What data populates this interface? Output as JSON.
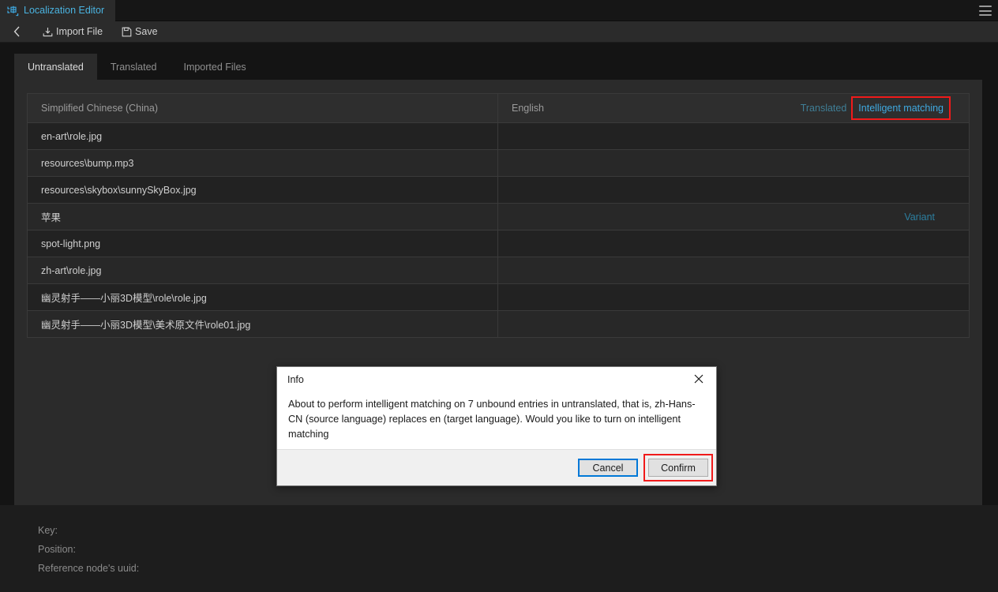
{
  "titlebar": {
    "editor_tab_label": "Localization Editor",
    "editor_tab_icon": "localization-icon",
    "menu_icon": "hamburger-menu-icon"
  },
  "toolbar": {
    "back_icon": "chevron-left-icon",
    "import_label": "Import File",
    "import_icon": "import-file-icon",
    "save_label": "Save",
    "save_icon": "save-disk-icon"
  },
  "tabs": [
    {
      "label": "Untranslated",
      "active": true
    },
    {
      "label": "Translated",
      "active": false
    },
    {
      "label": "Imported Files",
      "active": false
    }
  ],
  "table": {
    "header": {
      "source_column": "Simplified Chinese (China)",
      "target_column": "English",
      "translated_action": "Translated",
      "intelligent_matching_action": "Intelligent matching"
    },
    "rows": [
      {
        "source": "en-art\\role.jpg",
        "target": "",
        "badge": ""
      },
      {
        "source": "resources\\bump.mp3",
        "target": "",
        "badge": ""
      },
      {
        "source": "resources\\skybox\\sunnySkyBox.jpg",
        "target": "",
        "badge": ""
      },
      {
        "source": "苹果",
        "target": "",
        "badge": "Variant"
      },
      {
        "source": "spot-light.png",
        "target": "",
        "badge": ""
      },
      {
        "source": "zh-art\\role.jpg",
        "target": "",
        "badge": ""
      },
      {
        "source": "幽灵射手——小丽3D模型\\role\\role.jpg",
        "target": "",
        "badge": ""
      },
      {
        "source": "幽灵射手——小丽3D模型\\美术原文件\\role01.jpg",
        "target": "",
        "badge": ""
      }
    ]
  },
  "footer": {
    "key_label": "Key:",
    "position_label": "Position:",
    "uuid_label": "Reference node's uuid:"
  },
  "dialog": {
    "title": "Info",
    "close_icon": "close-icon",
    "message": "About to perform intelligent matching on 7 unbound entries in untranslated, that is, zh-Hans-CN (source language) replaces en (target language). Would you like to turn on intelligent matching",
    "cancel_label": "Cancel",
    "confirm_label": "Confirm"
  },
  "colors": {
    "accent_blue": "#3fa9e0",
    "tab_blue": "#4ab3e0",
    "variant_teal": "#2c7fa0",
    "highlight_red": "#f01a1a",
    "focus_blue": "#0078d7",
    "panel_bg": "#2b2b2b",
    "app_bg": "#141414"
  }
}
